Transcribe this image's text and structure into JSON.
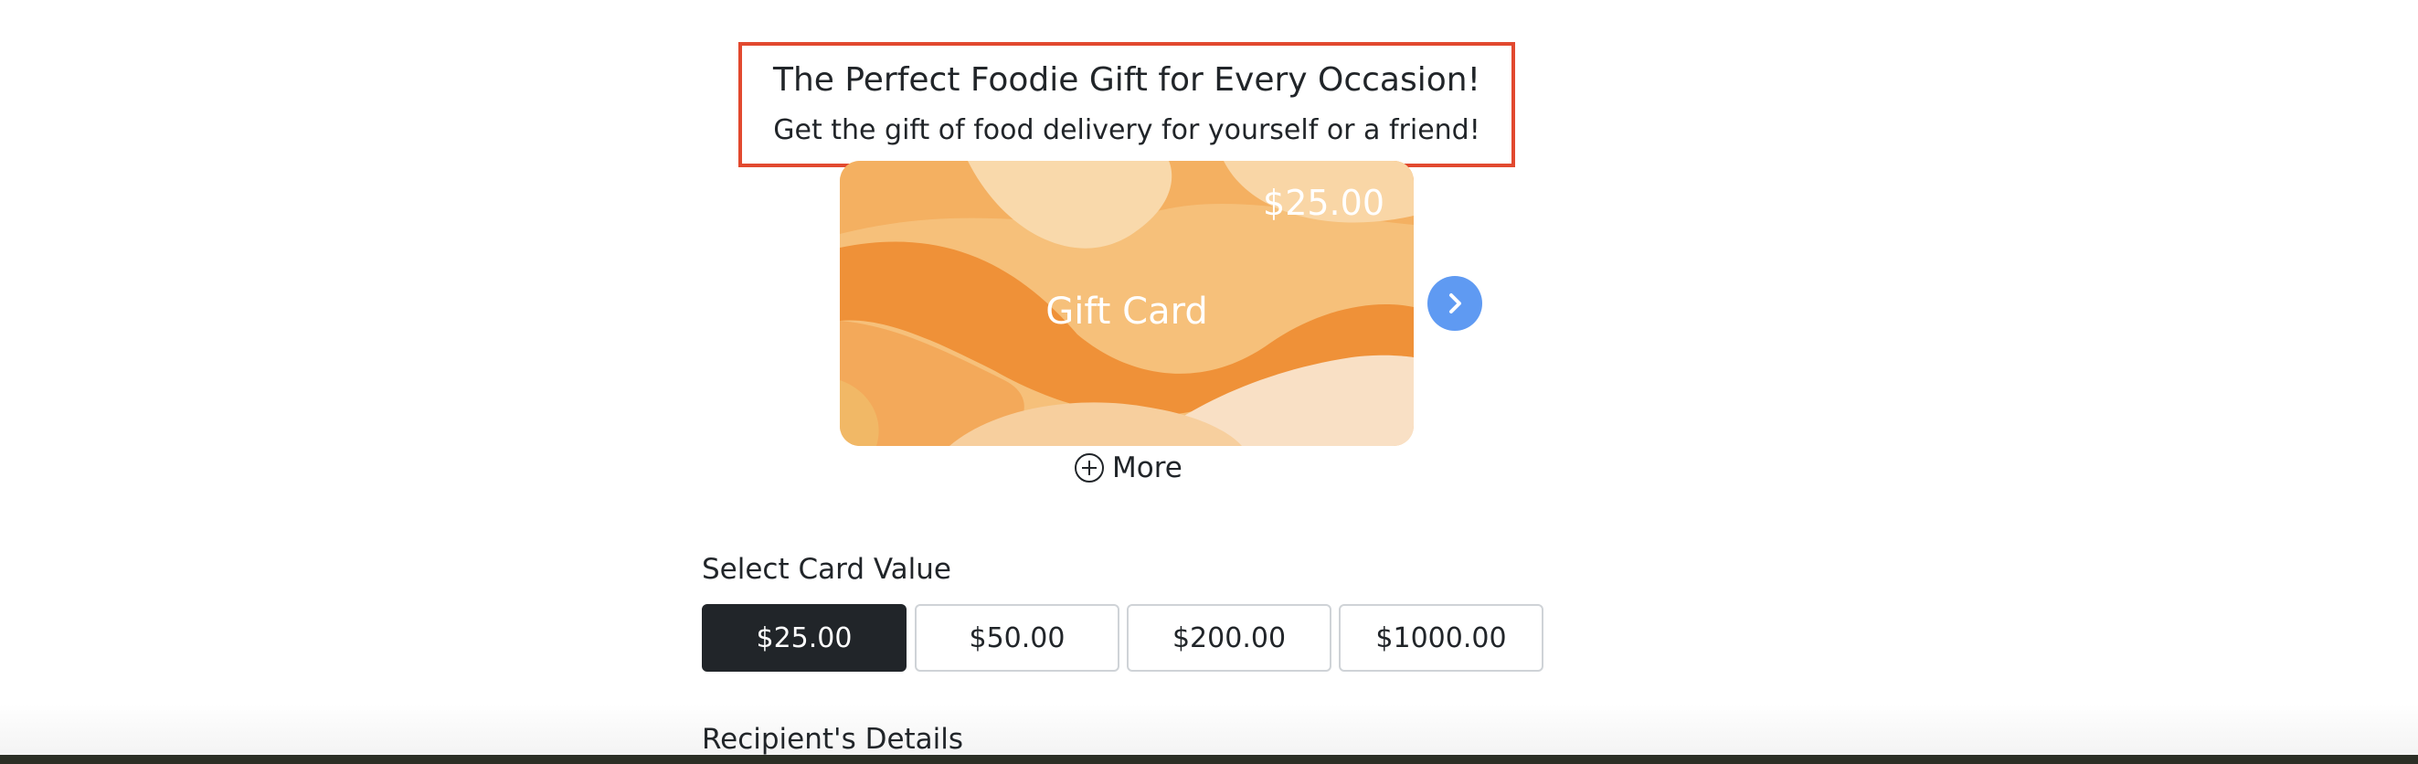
{
  "banner": {
    "title": "The Perfect Foodie Gift for Every Occasion!",
    "subtitle": "Get the gift of food delivery for yourself or a friend!"
  },
  "gift_card": {
    "amount": "$25.00",
    "label": "Gift Card",
    "palette": [
      "#f4b061",
      "#f8d3a0",
      "#ef9138",
      "#f7c27c",
      "#f9e0c5"
    ]
  },
  "carousel": {
    "next_icon": "chevron-right-icon",
    "accent": "#5f9af2"
  },
  "more": {
    "label": "More",
    "icon": "plus-circle-icon"
  },
  "card_value": {
    "label": "Select Card Value",
    "options": [
      "$25.00",
      "$50.00",
      "$200.00",
      "$1000.00"
    ],
    "selected": "$25.00"
  },
  "recipient": {
    "label": "Recipient's Details"
  },
  "colors": {
    "highlight_border": "#e2492f",
    "selected_button": "#212529"
  }
}
